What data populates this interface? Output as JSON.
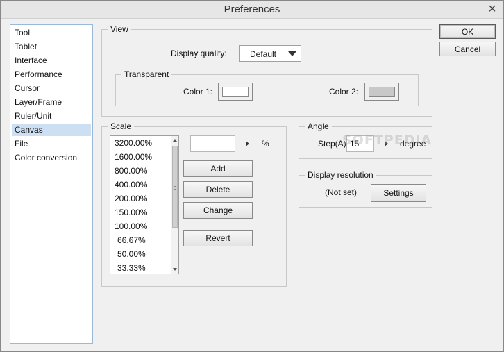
{
  "window": {
    "title": "Preferences"
  },
  "buttons": {
    "ok": "OK",
    "cancel": "Cancel"
  },
  "sidebar": {
    "items": [
      {
        "label": "Tool"
      },
      {
        "label": "Tablet"
      },
      {
        "label": "Interface"
      },
      {
        "label": "Performance"
      },
      {
        "label": "Cursor"
      },
      {
        "label": "Layer/Frame"
      },
      {
        "label": "Ruler/Unit"
      },
      {
        "label": "Canvas",
        "selected": true
      },
      {
        "label": "File"
      },
      {
        "label": "Color conversion"
      }
    ]
  },
  "view": {
    "title": "View",
    "display_quality_label": "Display quality:",
    "display_quality_value": "Default",
    "transparent": {
      "title": "Transparent",
      "color1_label": "Color 1:",
      "color1_value": "#ffffff",
      "color2_label": "Color 2:",
      "color2_value": "#c8c8c8"
    }
  },
  "scale": {
    "title": "Scale",
    "values": [
      "3200.00%",
      "1600.00%",
      "800.00%",
      "400.00%",
      "200.00%",
      "150.00%",
      "100.00%",
      "66.67%",
      "50.00%",
      "33.33%"
    ],
    "input_value": "",
    "unit": "%",
    "add_label": "Add",
    "delete_label": "Delete",
    "change_label": "Change",
    "revert_label": "Revert"
  },
  "angle": {
    "title": "Angle",
    "step_label": "Step(A):",
    "step_value": "15",
    "unit": "degree"
  },
  "display_resolution": {
    "title": "Display resolution",
    "status": "(Not set)",
    "settings_label": "Settings"
  },
  "watermark": "SOFTPEDIA"
}
